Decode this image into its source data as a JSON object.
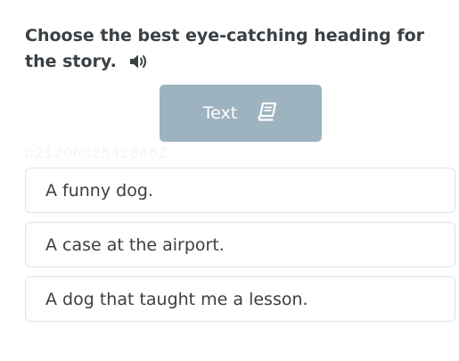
{
  "question": {
    "text": "Choose the best eye-catching heading for the story.",
    "audio_icon": "speaker-icon"
  },
  "text_button": {
    "label": "Text",
    "icon": "book-icon",
    "bg_color": "#9db3bf"
  },
  "watermark": "02120602542846Z",
  "options": [
    {
      "label": "A funny dog."
    },
    {
      "label": "A case at the airport."
    },
    {
      "label": "A dog that taught me a lesson."
    }
  ]
}
